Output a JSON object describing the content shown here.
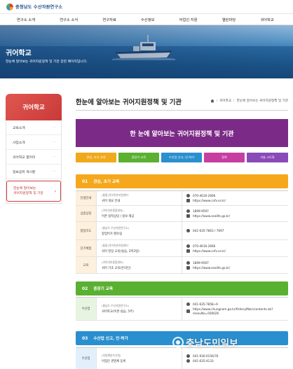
{
  "site": {
    "logo_text": "충청남도 수산자원연구소"
  },
  "nav": [
    "연구소 소개",
    "연구소 소식",
    "연구자료",
    "수산정보",
    "어업인 지원",
    "열린마당",
    "귀어학교"
  ],
  "hero": {
    "title": "귀어학교",
    "subtitle": "한눈에 알아보는 귀어지원정책 및 기관 관련 페이지입니다."
  },
  "sidebar": {
    "title": "귀어학교",
    "items": [
      {
        "label": "교육소개"
      },
      {
        "label": "사업소개"
      },
      {
        "label": "귀어학교 갤러리"
      },
      {
        "label": "정보공유 게시판"
      },
      {
        "label": "한눈에 알아보는 귀어지원정책 및 기관",
        "line1": "한눈에 알아보는",
        "line2": "귀어지원정책 및 기관"
      }
    ]
  },
  "page": {
    "title": "한눈에 알아보는 귀어지원정책 및 기관",
    "breadcrumb": [
      "홈",
      "귀어학교",
      "한눈에 알아보는 귀어지원정책 및 기관"
    ],
    "banner": "한 눈에 알아보는 귀어지원정책 및 기관"
  },
  "chips": [
    {
      "label": "관심, 초기 교육",
      "color": "#f0a91c"
    },
    {
      "label": "중장기 교육",
      "color": "#5ab031"
    },
    {
      "label": "수산업 신고, 인·허가",
      "color": "#2a8fcf"
    },
    {
      "label": "정착",
      "color": "#c63fa0"
    },
    {
      "label": "기술 고도화",
      "color": "#8a4ab8"
    }
  ],
  "sections": [
    {
      "num": "01",
      "title": "관심, 초기 교육",
      "color": "#f5a81c",
      "rows": [
        {
          "cat": "인생안내",
          "org1": "(통합)귀어귀촌지원센터",
          "org2": "귀어 개요 안내",
          "lines": [
            "070-4616-2666",
            "https://www.cnfv.or.kr/"
          ]
        },
        {
          "cat": "심층상담",
          "org1": "(귀어귀촌종합센터)",
          "org2": "어촌 정착상담 / 정보 제공",
          "lines": [
            "1899-9597",
            "https://www.sealife.go.kr/"
          ]
        },
        {
          "cat": "창업지도",
          "org1": "(충남도 수산자원연구소)",
          "org2": "창업어가 멘토링",
          "lines": [
            "041-635-7863 / 7697"
          ]
        },
        {
          "cat": "단기체험",
          "org1": "(통합)귀어귀촌지원센터",
          "org2": "귀어 현장 교육(실습, 2박3일)",
          "lines": [
            "070-4616-2666",
            "https://www.cnfv.or.kr/"
          ]
        },
        {
          "cat": "교육",
          "org1": "(귀어귀촌종합센터)",
          "org2": "귀어 기초 교육(온라인)",
          "lines": [
            "1899-9597",
            "https://www.sealife.go.kr/"
          ]
        }
      ]
    },
    {
      "num": "02",
      "title": "중장기 교육",
      "color": "#5ab031",
      "rows": [
        {
          "cat": "수산업",
          "org1": "(충남도 수산자원연구소)",
          "org2": "귀어학교(이론·실습, 5주)",
          "lines": [
            "041-635-7858~9",
            "https://www.chungnam.go.kr/fisheryMain/contents.do?menuNo=500026"
          ]
        }
      ]
    },
    {
      "num": "03",
      "title": "수산업 신고, 인·허가",
      "color": "#2a8fcf",
      "rows": [
        {
          "cat": "수산업",
          "org1": "(지방해양수산청)",
          "org2": "어업인 경영체 등록",
          "lines": [
            "041-930-0156/76",
            "041-635-4133"
          ]
        }
      ]
    }
  ]
}
